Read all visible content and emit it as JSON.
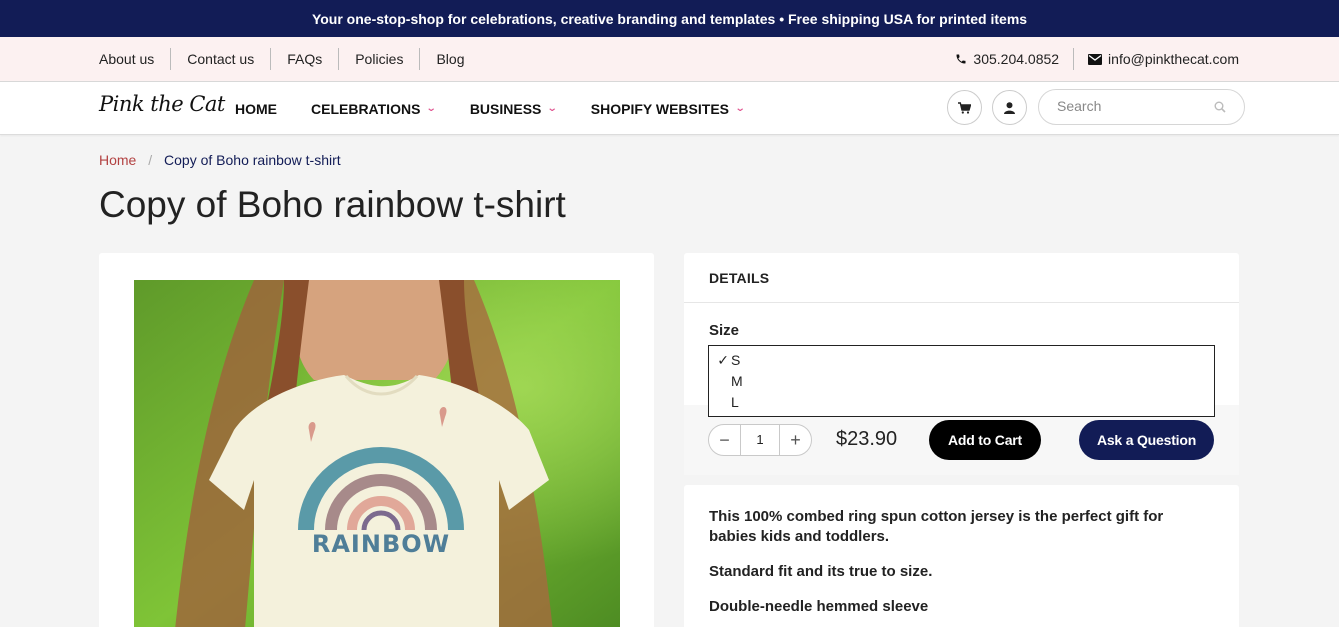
{
  "announcement": "Your one-stop-shop for celebrations, creative branding and templates • Free shipping USA for printed items",
  "topbar": {
    "links": [
      "About us",
      "Contact us",
      "FAQs",
      "Policies",
      "Blog"
    ],
    "phone": "305.204.0852",
    "email": "info@pinkthecat.com"
  },
  "nav": {
    "logo": "Pink the Cat",
    "items": [
      "HOME",
      "CELEBRATIONS",
      "BUSINESS",
      "SHOPIFY WEBSITES"
    ],
    "search_placeholder": "Search"
  },
  "breadcrumb": {
    "home": "Home",
    "separator": "/",
    "current": "Copy of Boho rainbow t-shirt"
  },
  "product": {
    "title": "Copy of Boho rainbow t-shirt",
    "details_heading": "DETAILS",
    "size_label": "Size",
    "size_options": [
      "S",
      "M",
      "L"
    ],
    "selected_size": "S",
    "check_mark": "✓",
    "quantity": "1",
    "price": "$23.90",
    "add_to_cart": "Add to Cart",
    "ask_question": "Ask a Question",
    "shirt_print": "RAINBOW",
    "description": [
      "This 100% combed ring spun cotton jersey is the perfect gift for babies kids and toddlers.",
      "Standard fit and its true to size.",
      "Double-needle hemmed sleeve"
    ]
  },
  "colors": {
    "announcement_bg": "#121c56",
    "accent_pink": "#e0528f",
    "breadcrumb_home": "#b24141",
    "add_to_cart_bg": "#000000",
    "ask_question_bg": "#121c56"
  }
}
